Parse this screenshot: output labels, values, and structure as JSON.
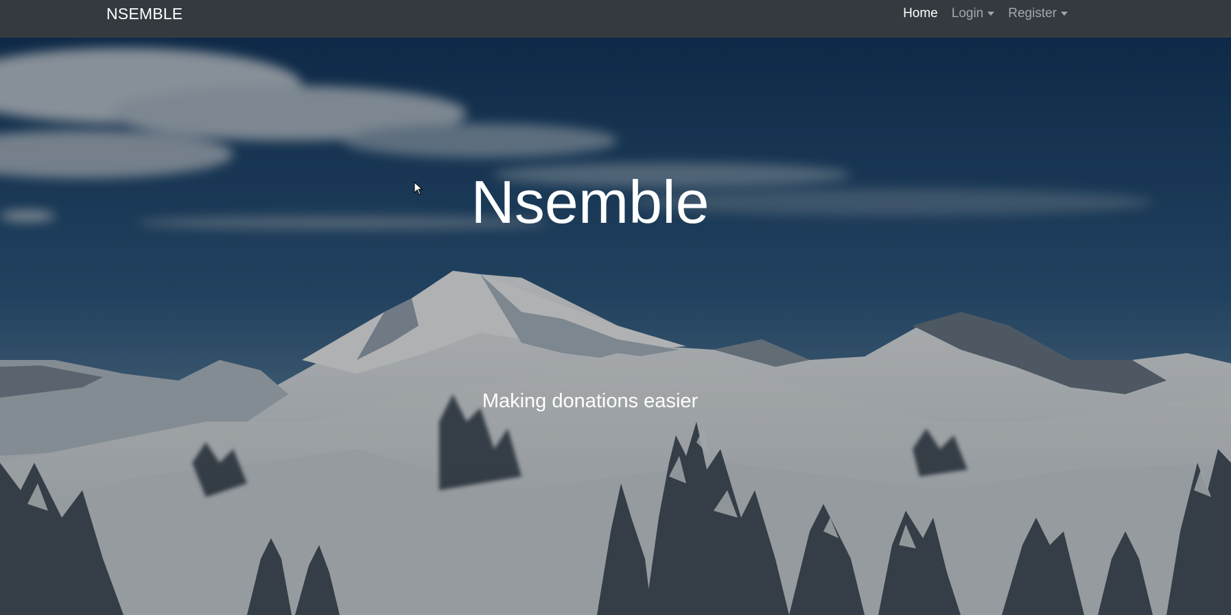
{
  "navbar": {
    "brand": "NSEMBLE",
    "items": [
      {
        "label": "Home",
        "active": true,
        "dropdown": false
      },
      {
        "label": "Login",
        "active": false,
        "dropdown": true
      },
      {
        "label": "Register",
        "active": false,
        "dropdown": true
      }
    ]
  },
  "hero": {
    "title": "Nsemble",
    "subtitle": "Making donations easier",
    "background_image": "snowy-mountain-landscape"
  },
  "colors": {
    "navbar_bg": "#343a40",
    "nav_active": "#ffffff",
    "nav_inactive": "rgba(255,255,255,0.55)",
    "sky_top": "#0d2a4d",
    "snow": "#d9dee3"
  }
}
